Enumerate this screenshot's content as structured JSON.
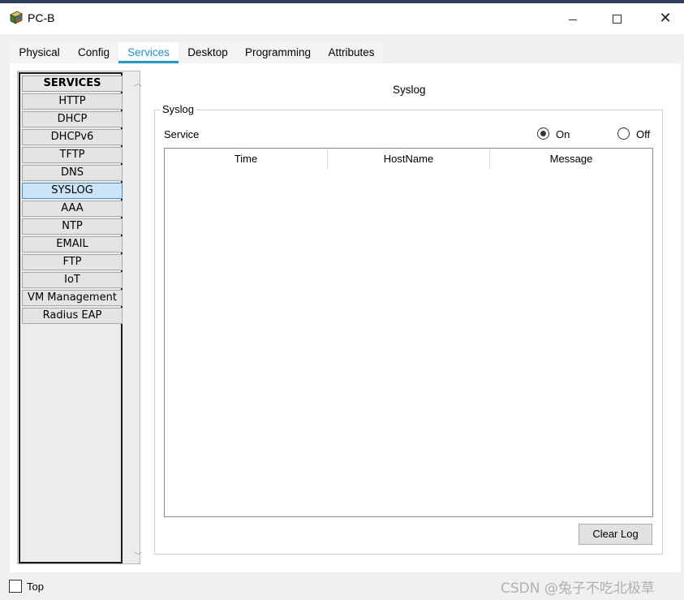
{
  "window": {
    "title": "PC-B",
    "app_icon": "packet-tracer-pc-icon",
    "controls": {
      "minimize": "minimize",
      "maximize": "maximize",
      "close": "close"
    }
  },
  "tabs": [
    {
      "label": "Physical"
    },
    {
      "label": "Config"
    },
    {
      "label": "Services",
      "selected": true
    },
    {
      "label": "Desktop"
    },
    {
      "label": "Programming"
    },
    {
      "label": "Attributes"
    }
  ],
  "services": {
    "header": "SERVICES",
    "items": [
      {
        "label": "HTTP"
      },
      {
        "label": "DHCP"
      },
      {
        "label": "DHCPv6"
      },
      {
        "label": "TFTP"
      },
      {
        "label": "DNS"
      },
      {
        "label": "SYSLOG",
        "selected": true
      },
      {
        "label": "AAA"
      },
      {
        "label": "NTP"
      },
      {
        "label": "EMAIL"
      },
      {
        "label": "FTP"
      },
      {
        "label": "IoT"
      },
      {
        "label": "VM Management"
      },
      {
        "label": "Radius EAP"
      }
    ]
  },
  "syslog": {
    "page_title": "Syslog",
    "group_title": "Syslog",
    "service_label": "Service",
    "on_label": "On",
    "off_label": "Off",
    "service_state": "On",
    "columns": [
      "Time",
      "HostName",
      "Message"
    ],
    "rows": [],
    "clear_button": "Clear Log"
  },
  "footer": {
    "top_label": "Top",
    "top_checked": false,
    "watermark": "CSDN @兔子不吃北极草"
  },
  "colors": {
    "accent_tab": "#1f9ad6",
    "selected_item_bg": "#cce4f7"
  }
}
